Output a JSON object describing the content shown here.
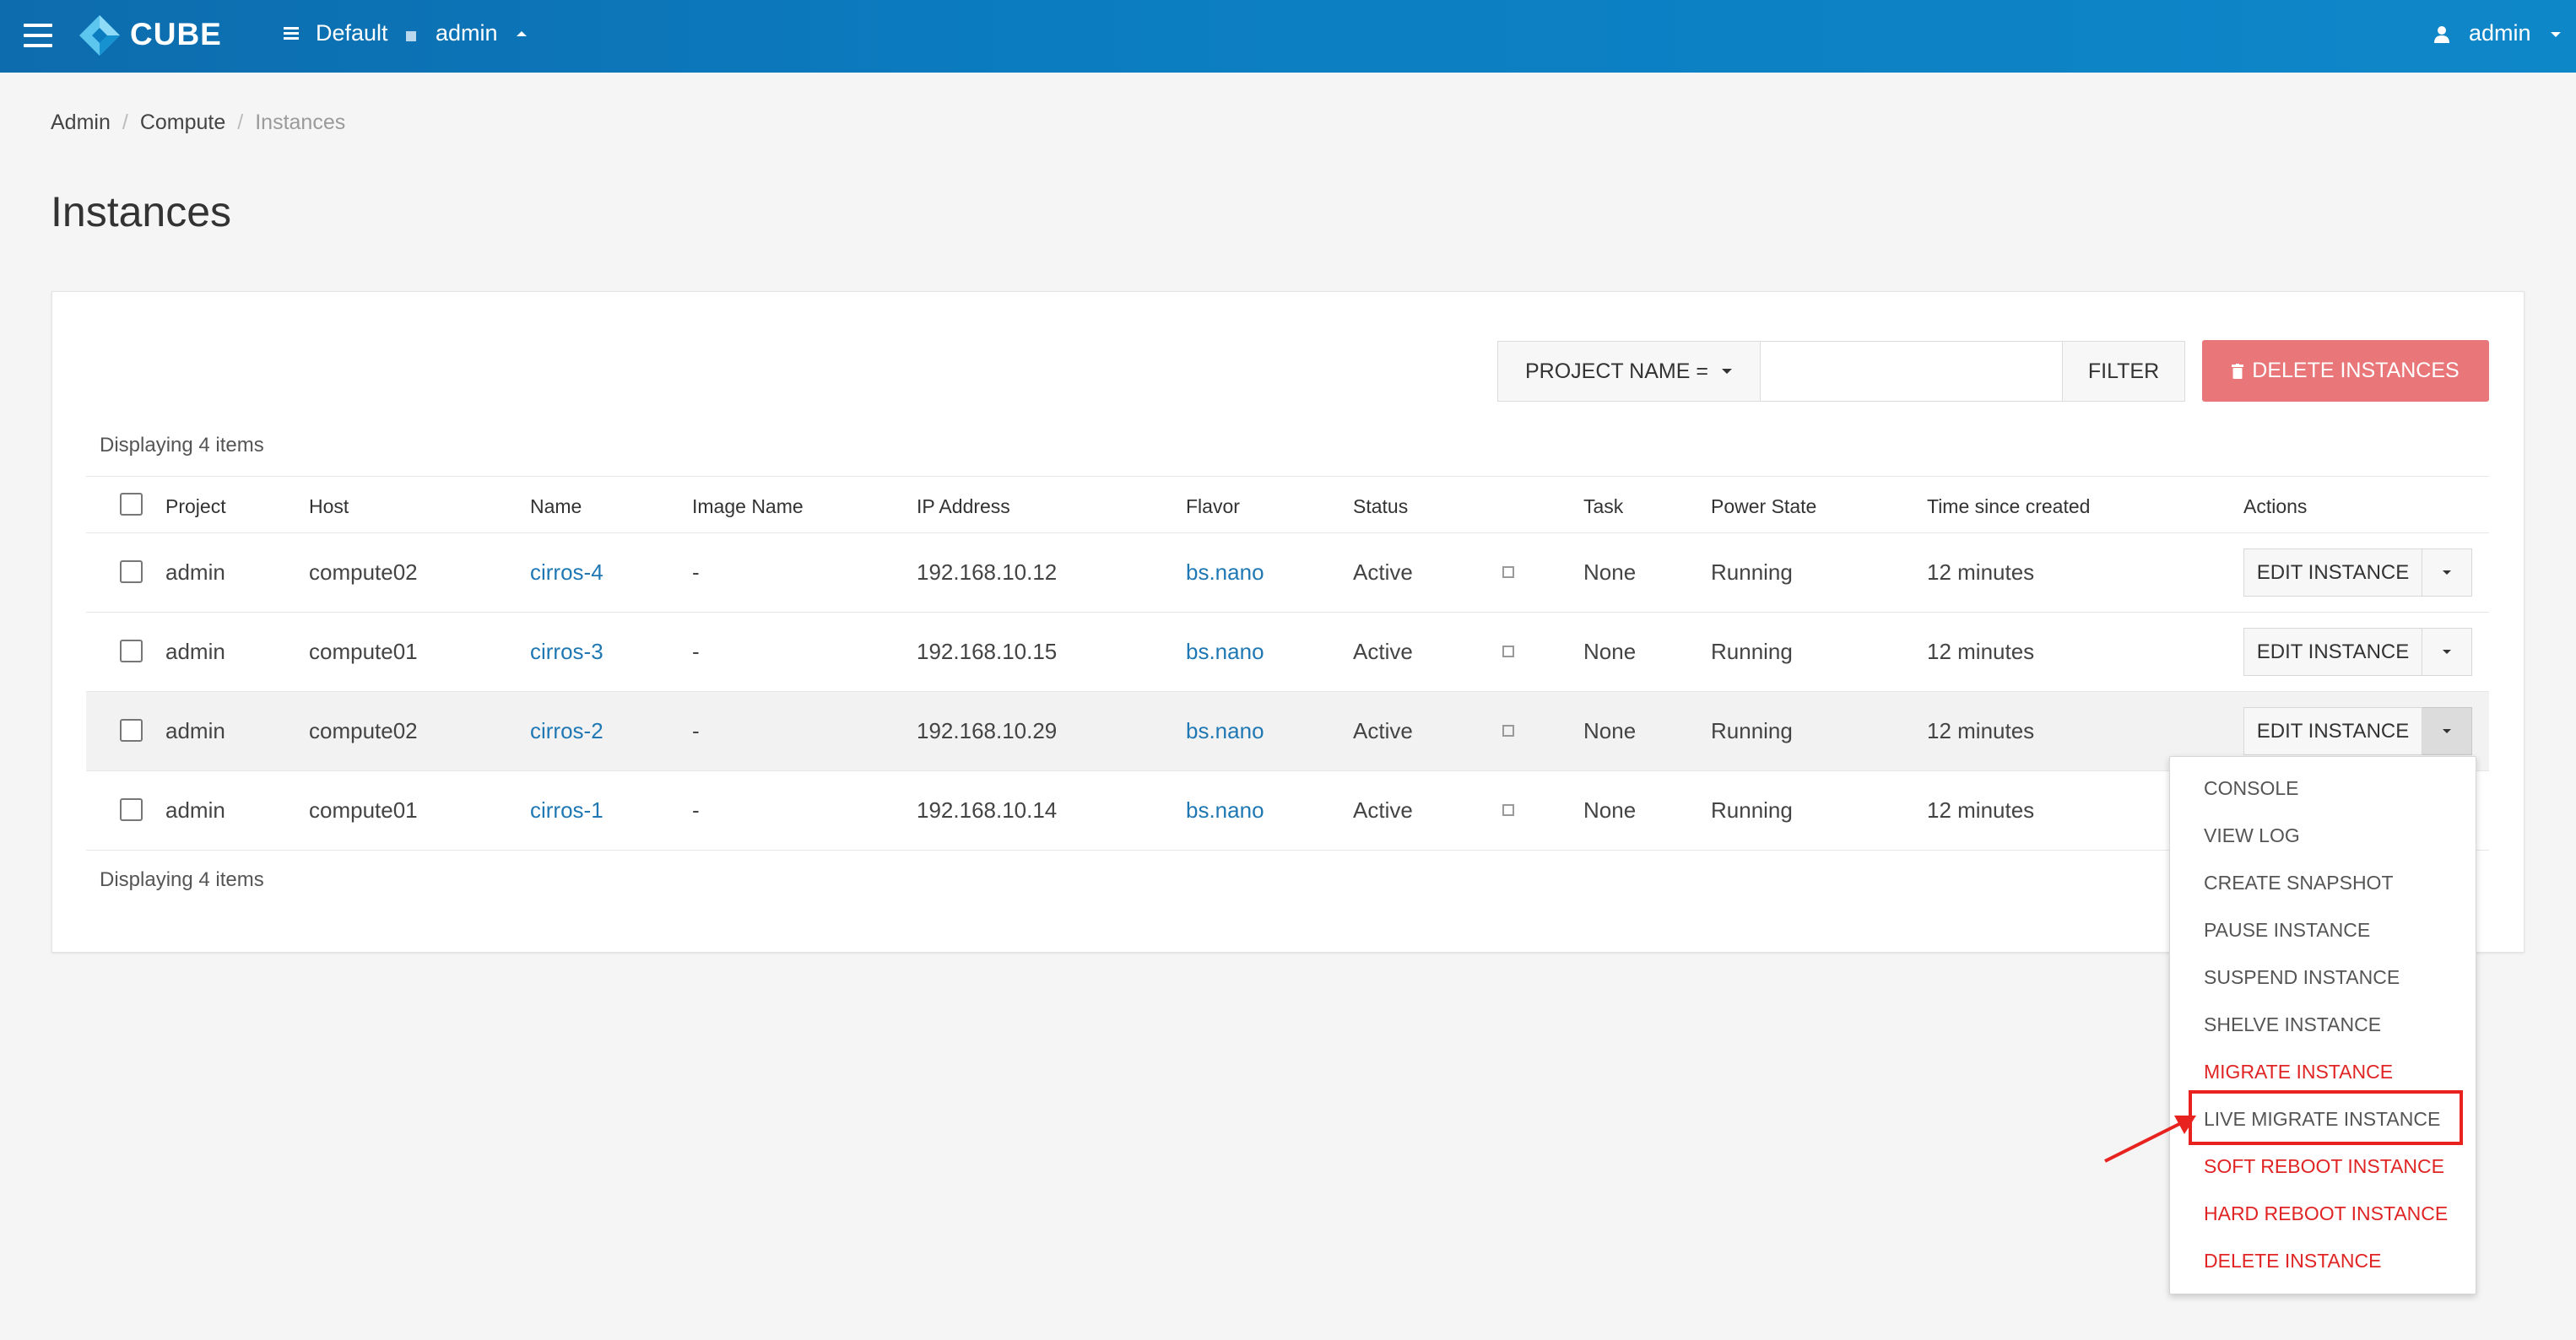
{
  "header": {
    "brand": "CUBE",
    "domain": "Default",
    "project": "admin",
    "user": "admin",
    "colors": {
      "bar": "#0b7cc0",
      "logo_light": "#5cc6ef",
      "logo_dark": "#1592cf"
    }
  },
  "breadcrumb": [
    "Admin",
    "Compute",
    "Instances"
  ],
  "page_title": "Instances",
  "toolbar": {
    "filter_field": "PROJECT NAME =",
    "filter_value": "",
    "filter_button": "FILTER",
    "delete_button": "DELETE INSTANCES",
    "delete_color": "#e9777a"
  },
  "count_text": "Displaying 4 items",
  "columns": [
    "Project",
    "Host",
    "Name",
    "Image Name",
    "IP Address",
    "Flavor",
    "Status",
    "Task",
    "Power State",
    "Time since created",
    "Actions"
  ],
  "rows": [
    {
      "project": "admin",
      "host": "compute02",
      "name": "cirros-4",
      "image": "-",
      "ip": "192.168.10.12",
      "flavor": "bs.nano",
      "status": "Active",
      "task": "None",
      "power": "Running",
      "age": "12 minutes",
      "action": "EDIT INSTANCE"
    },
    {
      "project": "admin",
      "host": "compute01",
      "name": "cirros-3",
      "image": "-",
      "ip": "192.168.10.15",
      "flavor": "bs.nano",
      "status": "Active",
      "task": "None",
      "power": "Running",
      "age": "12 minutes",
      "action": "EDIT INSTANCE"
    },
    {
      "project": "admin",
      "host": "compute02",
      "name": "cirros-2",
      "image": "-",
      "ip": "192.168.10.29",
      "flavor": "bs.nano",
      "status": "Active",
      "task": "None",
      "power": "Running",
      "age": "12 minutes",
      "action": "EDIT INSTANCE"
    },
    {
      "project": "admin",
      "host": "compute01",
      "name": "cirros-1",
      "image": "-",
      "ip": "192.168.10.14",
      "flavor": "bs.nano",
      "status": "Active",
      "task": "None",
      "power": "Running",
      "age": "12 minutes",
      "action": "EDIT INSTANCE"
    }
  ],
  "actions_menu": [
    {
      "label": "CONSOLE",
      "danger": false
    },
    {
      "label": "VIEW LOG",
      "danger": false
    },
    {
      "label": "CREATE SNAPSHOT",
      "danger": false
    },
    {
      "label": "PAUSE INSTANCE",
      "danger": false
    },
    {
      "label": "SUSPEND INSTANCE",
      "danger": false
    },
    {
      "label": "SHELVE INSTANCE",
      "danger": false
    },
    {
      "label": "MIGRATE INSTANCE",
      "danger": true
    },
    {
      "label": "LIVE MIGRATE INSTANCE",
      "danger": false,
      "highlighted": true
    },
    {
      "label": "SOFT REBOOT INSTANCE",
      "danger": true
    },
    {
      "label": "HARD REBOOT INSTANCE",
      "danger": true
    },
    {
      "label": "DELETE INSTANCE",
      "danger": true
    }
  ],
  "annotation_color": "#e8231f"
}
